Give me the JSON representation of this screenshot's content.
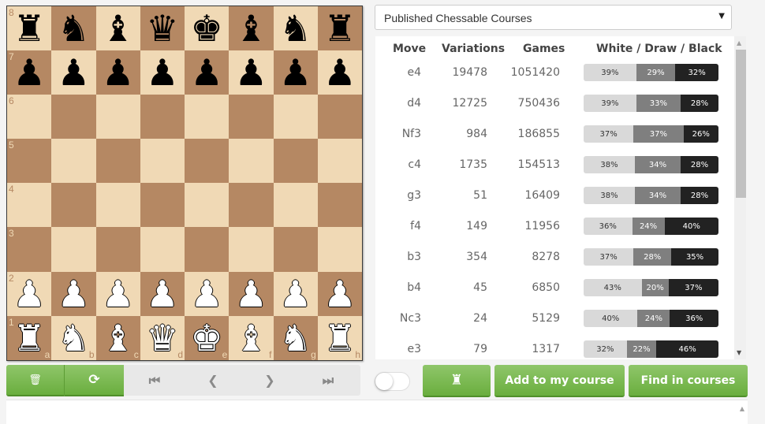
{
  "board": {
    "ranks": [
      "8",
      "7",
      "6",
      "5",
      "4",
      "3",
      "2",
      "1"
    ],
    "files": [
      "a",
      "b",
      "c",
      "d",
      "e",
      "f",
      "g",
      "h"
    ],
    "light_color": "#f0d9b5",
    "dark_color": "#b58863",
    "position": [
      [
        "bR",
        "bN",
        "bB",
        "bQ",
        "bK",
        "bB",
        "bN",
        "bR"
      ],
      [
        "bP",
        "bP",
        "bP",
        "bP",
        "bP",
        "bP",
        "bP",
        "bP"
      ],
      [
        "",
        "",
        "",
        "",
        "",
        "",
        "",
        ""
      ],
      [
        "",
        "",
        "",
        "",
        "",
        "",
        "",
        ""
      ],
      [
        "",
        "",
        "",
        "",
        "",
        "",
        "",
        ""
      ],
      [
        "",
        "",
        "",
        "",
        "",
        "",
        "",
        ""
      ],
      [
        "wP",
        "wP",
        "wP",
        "wP",
        "wP",
        "wP",
        "wP",
        "wP"
      ],
      [
        "wR",
        "wN",
        "wB",
        "wQ",
        "wK",
        "wB",
        "wN",
        "wR"
      ]
    ]
  },
  "database_select": {
    "value": "Published Chessable Courses",
    "caret": "▼"
  },
  "moves_table": {
    "headers": {
      "move": "Move",
      "variations": "Variations",
      "games": "Games",
      "result": "White / Draw / Black"
    },
    "rows": [
      {
        "move": "e4",
        "variations": "19478",
        "games": "1051420",
        "white": 39,
        "draw": 29,
        "black": 32
      },
      {
        "move": "d4",
        "variations": "12725",
        "games": "750436",
        "white": 39,
        "draw": 33,
        "black": 28
      },
      {
        "move": "Nf3",
        "variations": "984",
        "games": "186855",
        "white": 37,
        "draw": 37,
        "black": 26
      },
      {
        "move": "c4",
        "variations": "1735",
        "games": "154513",
        "white": 38,
        "draw": 34,
        "black": 28
      },
      {
        "move": "g3",
        "variations": "51",
        "games": "16409",
        "white": 38,
        "draw": 34,
        "black": 28
      },
      {
        "move": "f4",
        "variations": "149",
        "games": "11956",
        "white": 36,
        "draw": 24,
        "black": 40
      },
      {
        "move": "b3",
        "variations": "354",
        "games": "8278",
        "white": 37,
        "draw": 28,
        "black": 35
      },
      {
        "move": "b4",
        "variations": "45",
        "games": "6850",
        "white": 43,
        "draw": 20,
        "black": 37
      },
      {
        "move": "Nc3",
        "variations": "24",
        "games": "5129",
        "white": 40,
        "draw": 24,
        "black": 36
      },
      {
        "move": "e3",
        "variations": "79",
        "games": "1317",
        "white": 32,
        "draw": 22,
        "black": 46
      }
    ],
    "colors": {
      "white": "#d9d9d9",
      "draw": "#7f7f7f",
      "black": "#222222"
    }
  },
  "controls": {
    "trash_icon": "🗑",
    "flip_icon": "⟳",
    "first_icon": "⏮",
    "prev_icon": "❮",
    "next_icon": "❯",
    "last_icon": "⏭"
  },
  "actions": {
    "analysis_icon": "♜",
    "add_to_course": "Add to my course",
    "find_in_courses": "Find in courses",
    "accent": "#6aae3e"
  },
  "scrollbar": {
    "up": "▲",
    "down": "▼"
  }
}
